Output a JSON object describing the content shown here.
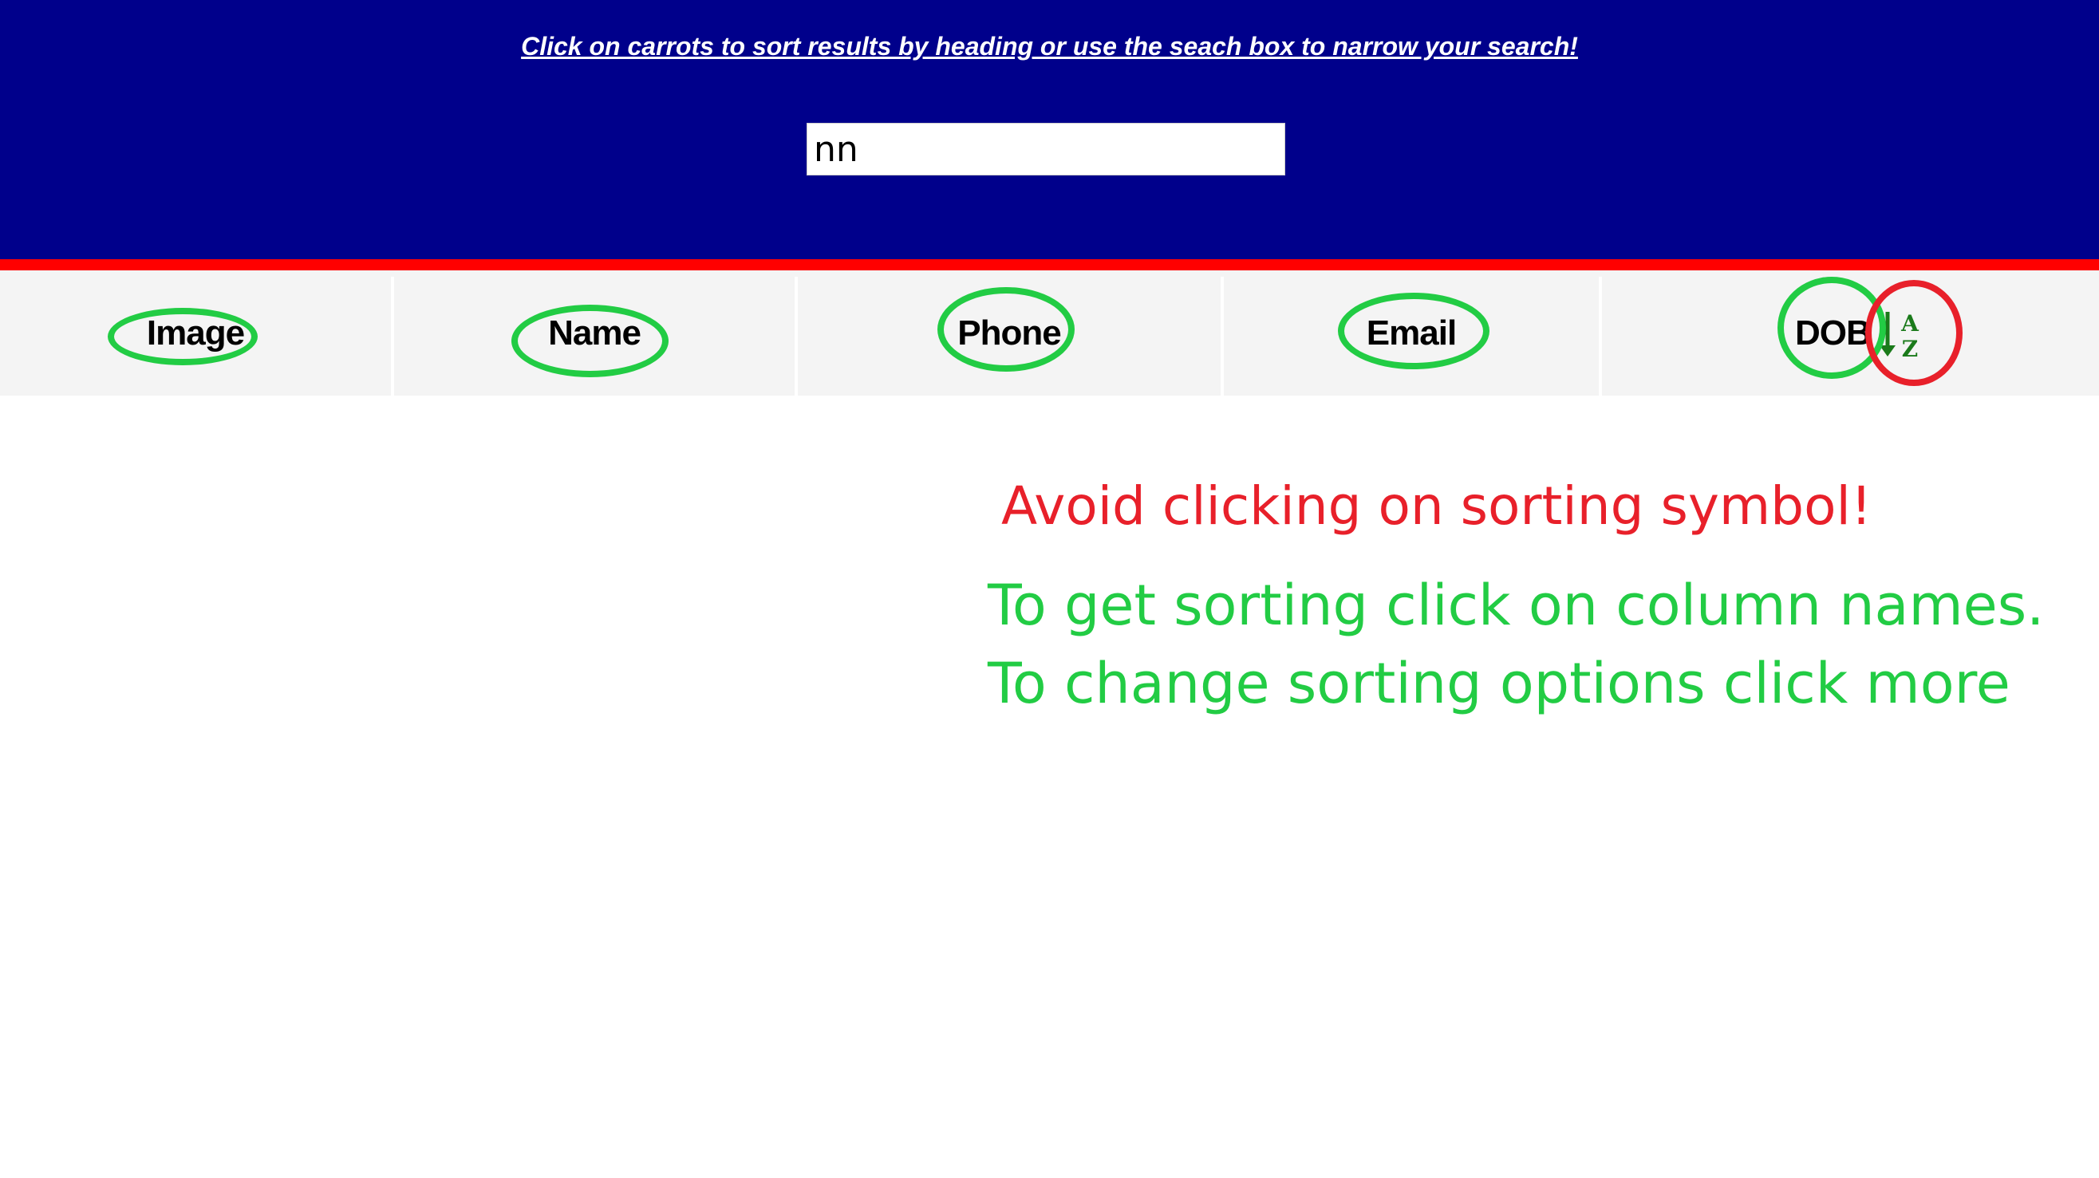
{
  "header": {
    "instructions": "Click on carrots to sort results by heading or use the seach box to narrow your search!",
    "background_color": "#00008b",
    "stripe_color": "#ff0000"
  },
  "search": {
    "value": "nn",
    "placeholder": ""
  },
  "table_header": {
    "columns": [
      {
        "label": "Image"
      },
      {
        "label": "Name"
      },
      {
        "label": "Phone"
      },
      {
        "label": "Email"
      },
      {
        "label": "DOB"
      }
    ],
    "sort_icon": {
      "name": "sort-a-z-icon",
      "top_letter": "A",
      "bottom_letter": "Z",
      "color": "#1a7a1a"
    }
  },
  "annotations": {
    "warning": "Avoid clicking on sorting symbol!",
    "tip_line1": "To get sorting click on column names.",
    "tip_line2": "To change sorting options click more",
    "highlight_color": "#22cc44",
    "warning_color": "#e8202a"
  }
}
